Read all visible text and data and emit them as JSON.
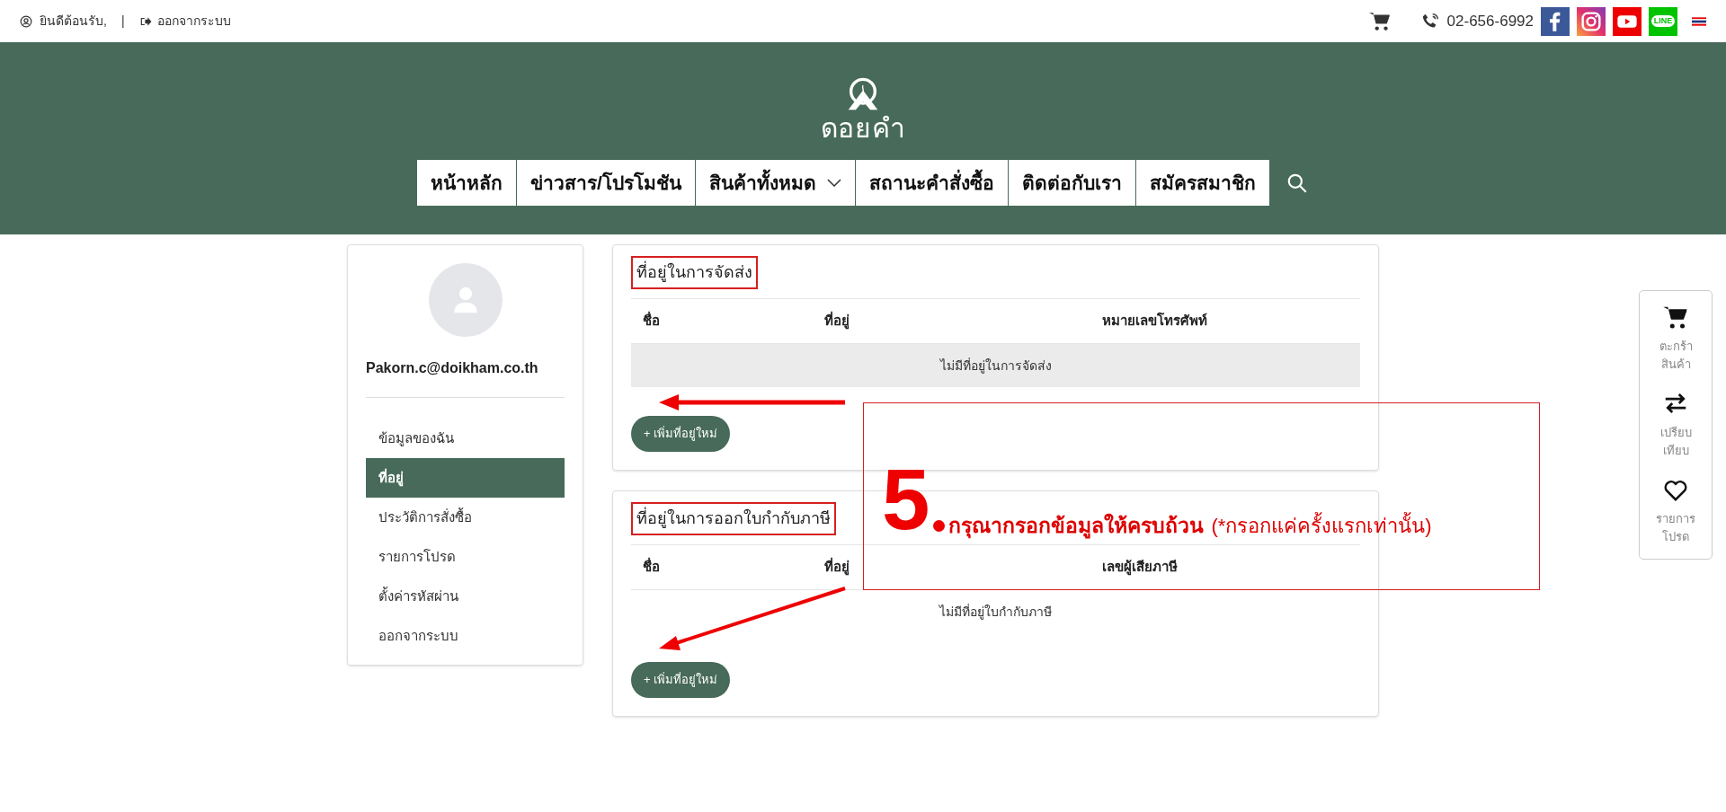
{
  "top_bar": {
    "greeting": "ยินดีต้อนรับ,",
    "separator": "|",
    "logout": "ออกจากระบบ",
    "phone": "02-656-6992",
    "line_badge": "LINE"
  },
  "brand": {
    "name": "ดอยคำ"
  },
  "nav": [
    {
      "label": "หน้าหลัก",
      "kind": "link"
    },
    {
      "label": "ข่าวสาร/โปรโมชัน",
      "kind": "link"
    },
    {
      "label": "สินค้าทั้งหมด",
      "kind": "dropdown"
    },
    {
      "label": "สถานะคำสั่งซื้อ",
      "kind": "link"
    },
    {
      "label": "ติดต่อกับเรา",
      "kind": "link"
    },
    {
      "label": "สมัครสมาชิก",
      "kind": "link"
    }
  ],
  "sidebar": {
    "email": "Pakorn.c@doikham.co.th",
    "items": [
      {
        "label": "ข้อมูลของฉัน",
        "selected": false
      },
      {
        "label": "ที่อยู่",
        "selected": true
      },
      {
        "label": "ประวัติการสั่งซื้อ",
        "selected": false
      },
      {
        "label": "รายการโปรด",
        "selected": false
      },
      {
        "label": "ตั้งค่ารหัสผ่าน",
        "selected": false
      },
      {
        "label": "ออกจากระบบ",
        "selected": false
      }
    ]
  },
  "sections": [
    {
      "title": "ที่อยู่ในการจัดส่ง",
      "highlighted": true,
      "columns": [
        "ชื่อ",
        "ที่อยู่",
        "หมายเลขโทรศัพท์"
      ],
      "empty_text": "ไม่มีที่อยู่ในการจัดส่ง",
      "shaded": true,
      "button": "+ เพิ่มที่อยู่ใหม่"
    },
    {
      "title": "ที่อยู่ในการออกใบกำกับภาษี",
      "highlighted": true,
      "columns": [
        "ชื่อ",
        "ที่อยู่",
        "เลขผู้เสียภาษี"
      ],
      "empty_text": "ไม่มีที่อยู่ใบกำกับภาษี",
      "shaded": false,
      "button": "+ เพิ่มที่อยู่ใหม่"
    }
  ],
  "annotation": {
    "step": "5",
    "text": "กรุณากรอกข้อมูลให้ครบถ้วน",
    "note": "(*กรอกแค่ครั้งแรกเท่านั้น)"
  },
  "float_panel": [
    {
      "kind": "cart",
      "label": "ตะกร้าสินค้า"
    },
    {
      "kind": "compare",
      "label": "เปรียบเทียบ"
    },
    {
      "kind": "heart",
      "label": "รายการโปรด"
    }
  ]
}
